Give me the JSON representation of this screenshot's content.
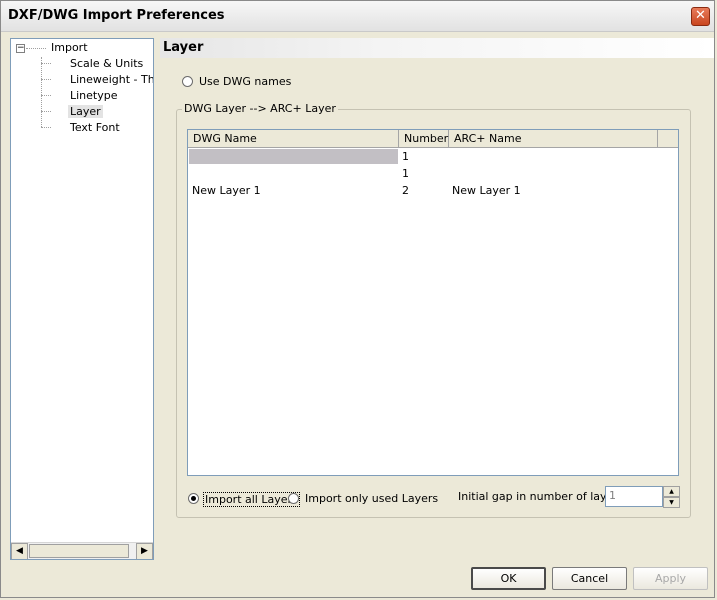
{
  "window": {
    "title": "DXF/DWG Import Preferences",
    "close_glyph": "✕"
  },
  "tree": {
    "root": {
      "label": "Import",
      "expander": "−"
    },
    "children": [
      {
        "label": "Scale & Units"
      },
      {
        "label": "Lineweight - Thick"
      },
      {
        "label": "Linetype"
      },
      {
        "label": "Layer",
        "selected": true
      },
      {
        "label": "Text Font"
      }
    ],
    "scroll_left": "◀",
    "scroll_right": "▶"
  },
  "panel": {
    "title": "Layer"
  },
  "use_dwg_names": {
    "label": "Use DWG names",
    "checked": false
  },
  "group": {
    "legend": "DWG Layer --> ARC+ Layer",
    "columns": [
      "DWG Name",
      "Number",
      "ARC+ Name"
    ],
    "rows": [
      {
        "dwg_name": "",
        "number": "1",
        "arc_name": ""
      },
      {
        "dwg_name": "",
        "number": "1",
        "arc_name": ""
      },
      {
        "dwg_name": "New Layer 1",
        "number": "2",
        "arc_name": "New Layer 1"
      }
    ],
    "import_all": {
      "label": "Import all Layers",
      "checked": true
    },
    "import_used": {
      "label": "Import only used Layers",
      "checked": false
    },
    "gap": {
      "label": "Initial gap in number of layers:",
      "value": "1",
      "up": "▲",
      "down": "▼"
    }
  },
  "buttons": {
    "ok": "OK",
    "cancel": "Cancel",
    "apply": "Apply"
  }
}
